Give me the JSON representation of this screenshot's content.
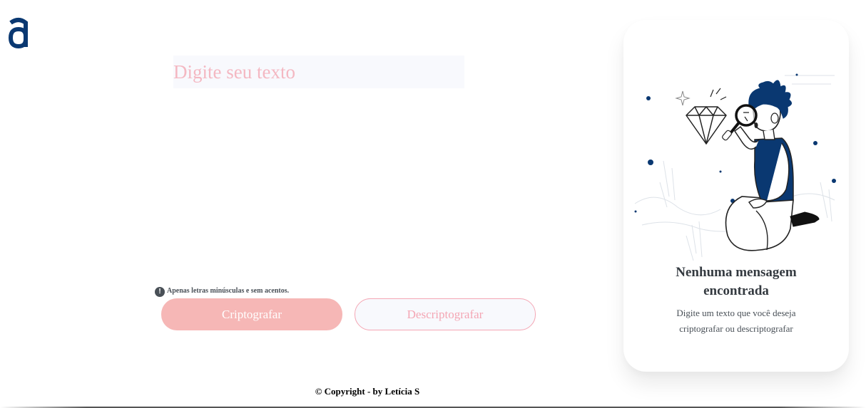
{
  "brand": {
    "logo_icon": "alura-logo-icon",
    "color": "#0a3871"
  },
  "input": {
    "placeholder": "Digite seu texto",
    "value": ""
  },
  "hint": {
    "icon": "exclamation-circle-icon",
    "text": "Apenas letras minúsculas e sem acentos."
  },
  "buttons": {
    "encrypt_label": "Criptografar",
    "decrypt_label": "Descriptografar"
  },
  "result_card": {
    "title": "Nenhuma mensagem encontrada",
    "description": "Digite um texto que você deseja criptografar ou descriptografar",
    "illustration": "person-with-magnifying-glass-illustration"
  },
  "footer": {
    "copyright": "© Copyright - by Letícia S"
  },
  "colors": {
    "accent": "#0a3871",
    "pink": "#f4a6b4",
    "button_fill": "#f6b7b6",
    "input_bg": "#f8f9fd"
  }
}
